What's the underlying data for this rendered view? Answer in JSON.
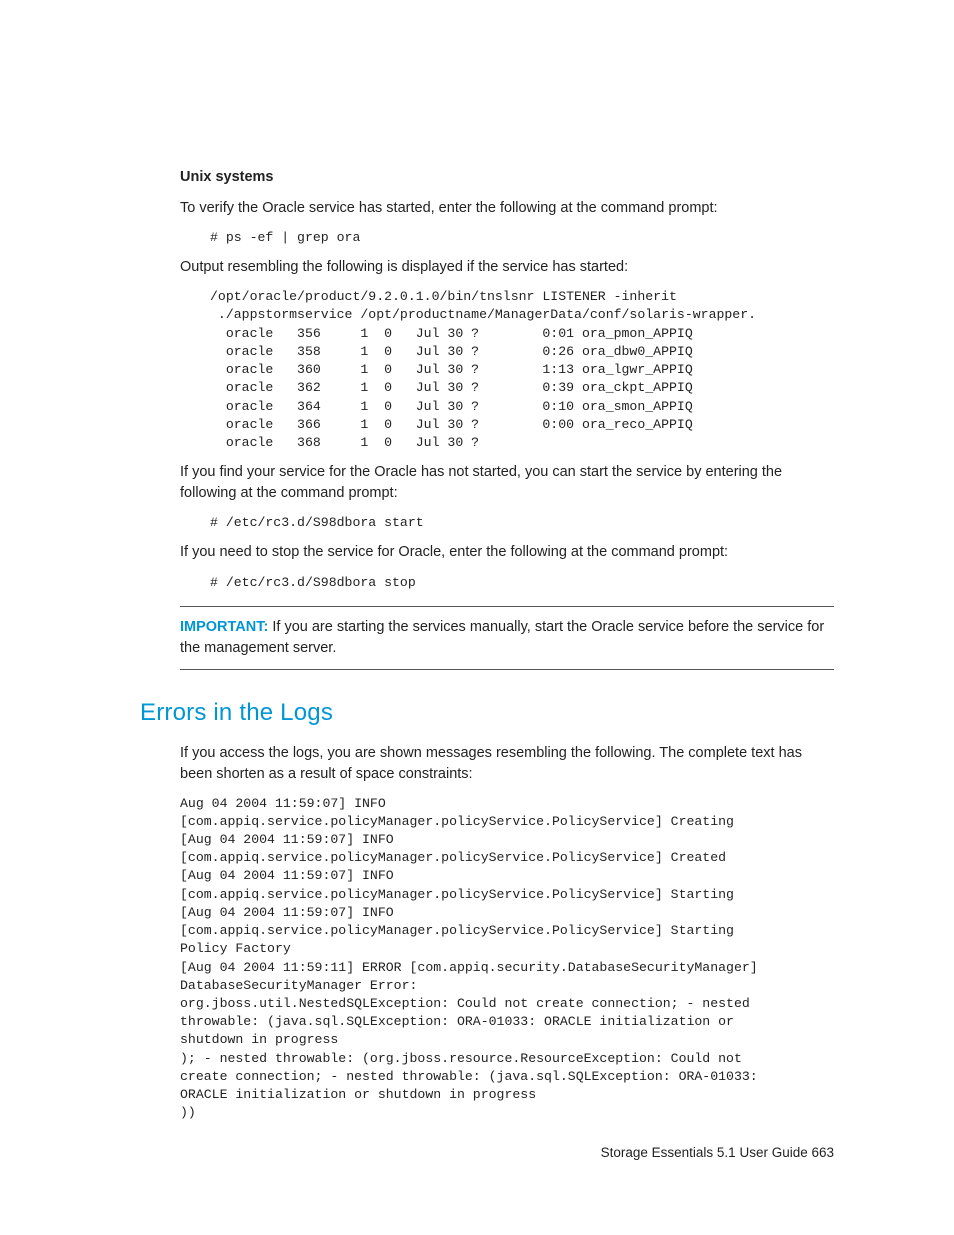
{
  "section1": {
    "heading": "Unix systems",
    "p1": "To verify the Oracle service has started, enter the following at the command prompt:",
    "code1": "# ps -ef | grep ora",
    "p2": "Output resembling the following is displayed if the service has started:",
    "code2": "/opt/oracle/product/9.2.0.1.0/bin/tnslsnr LISTENER -inherit\n ./appstormservice /opt/productname/ManagerData/conf/solaris-wrapper.\n  oracle   356     1  0   Jul 30 ?        0:01 ora_pmon_APPIQ\n  oracle   358     1  0   Jul 30 ?        0:26 ora_dbw0_APPIQ\n  oracle   360     1  0   Jul 30 ?        1:13 ora_lgwr_APPIQ\n  oracle   362     1  0   Jul 30 ?        0:39 ora_ckpt_APPIQ\n  oracle   364     1  0   Jul 30 ?        0:10 ora_smon_APPIQ\n  oracle   366     1  0   Jul 30 ?        0:00 ora_reco_APPIQ\n  oracle   368     1  0   Jul 30 ?",
    "p3": "If you find your service for the Oracle has not started, you can start the service by entering the following at the command prompt:",
    "code3": "# /etc/rc3.d/S98dbora start",
    "p4": "If you need to stop the service for Oracle, enter the following at the command prompt:",
    "code4": "# /etc/rc3.d/S98dbora stop",
    "important_label": "IMPORTANT:",
    "important_text": "  If you are starting the services manually, start the Oracle service before the service for the management server."
  },
  "section2": {
    "title": "Errors in the Logs",
    "p1": "If you access the logs, you are shown messages resembling the following. The complete text has been shorten as a result of space constraints:",
    "code1": "Aug 04 2004 11:59:07] INFO\n[com.appiq.service.policyManager.policyService.PolicyService] Creating\n[Aug 04 2004 11:59:07] INFO\n[com.appiq.service.policyManager.policyService.PolicyService] Created\n[Aug 04 2004 11:59:07] INFO\n[com.appiq.service.policyManager.policyService.PolicyService] Starting\n[Aug 04 2004 11:59:07] INFO\n[com.appiq.service.policyManager.policyService.PolicyService] Starting\nPolicy Factory\n[Aug 04 2004 11:59:11] ERROR [com.appiq.security.DatabaseSecurityManager]\nDatabaseSecurityManager Error:\norg.jboss.util.NestedSQLException: Could not create connection; - nested\nthrowable: (java.sql.SQLException: ORA-01033: ORACLE initialization or\nshutdown in progress\n); - nested throwable: (org.jboss.resource.ResourceException: Could not\ncreate connection; - nested throwable: (java.sql.SQLException: ORA-01033:\nORACLE initialization or shutdown in progress\n))"
  },
  "footer": {
    "text": "Storage Essentials 5.1 User Guide   663"
  }
}
